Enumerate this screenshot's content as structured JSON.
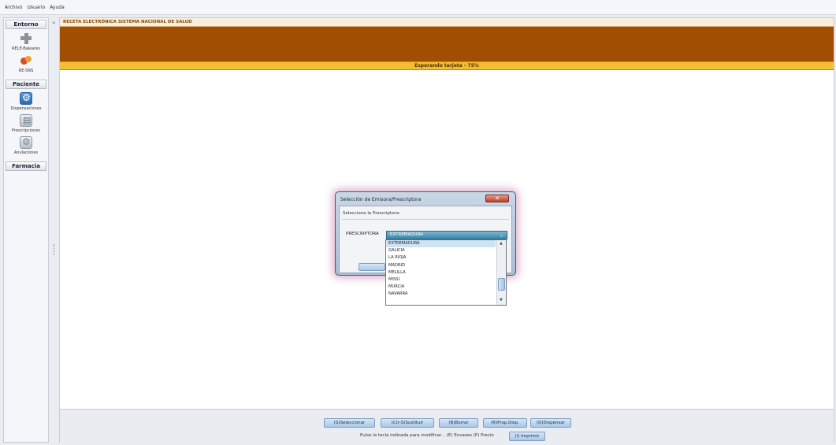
{
  "menu": [
    "Archivo",
    "Usuario",
    "Ayuda"
  ],
  "sidebar": {
    "sections": [
      {
        "title": "Entorno",
        "items": [
          {
            "label": "RELE-Baleares",
            "icon": "plus-icon"
          },
          {
            "label": "RE-SNS",
            "icon": "pill-icon"
          }
        ]
      },
      {
        "title": "Paciente",
        "items": [
          {
            "label": "Dispensaciones",
            "icon": "dispense-icon"
          },
          {
            "label": "Prescripciones",
            "icon": "prescription-icon"
          },
          {
            "label": "Anulaciones",
            "icon": "cancel-icon"
          }
        ]
      },
      {
        "title": "Farmacia",
        "items": []
      }
    ]
  },
  "main": {
    "title": "RECETA ELECTRÓNICA SISTEMA NACIONAL DE SALUD",
    "status": "Esperando tarjeta - 75%",
    "accent_brown": "#a24e00",
    "accent_yellow": "#f5bd33"
  },
  "dialog": {
    "title": "Selección de Emisora/Prescriptora",
    "subtitle": "Seleccione la Prescriptora:",
    "field_label": "PRESCRIPTORA",
    "selected": "EXTREMADURA",
    "options": [
      "EXTREMADURA",
      "GALICIA",
      "LA RIOJA",
      "MADRID",
      "MELILLA",
      "MISSI",
      "MURCIA",
      "NAVARRA"
    ]
  },
  "footer": {
    "buttons": [
      "(S)Seleccionar",
      "(Ctr-S)Sustituir",
      "(B)Borrar",
      "(R)Prop.Disp.",
      "(D)Dispensar"
    ],
    "hint": "Pulse la tecla indicada para modificar...  (E) Envases   (P) Precio",
    "print_button": "(I) Imprimir"
  }
}
